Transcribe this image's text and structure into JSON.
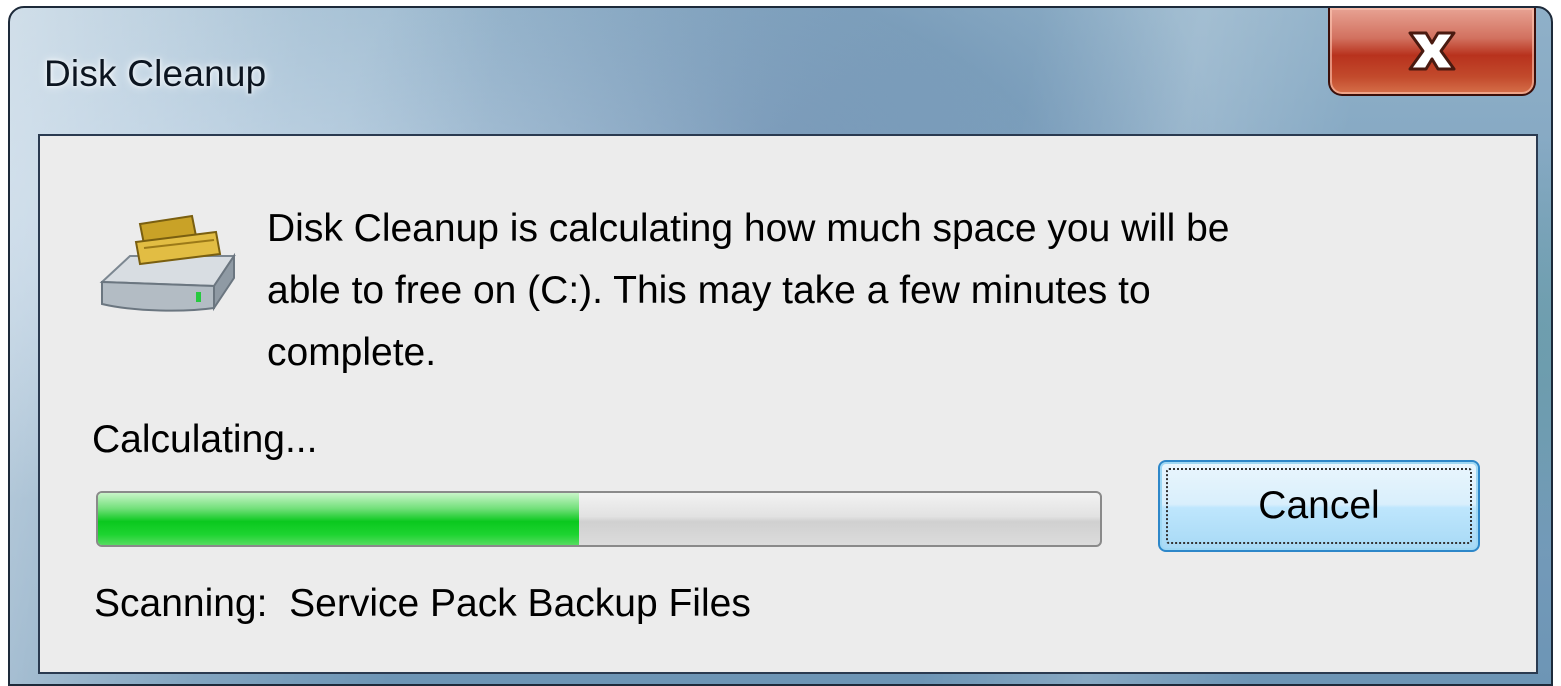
{
  "window": {
    "title": "Disk Cleanup"
  },
  "title_bar": {
    "close_icon": "close-x-icon",
    "close_color": "#c0392b"
  },
  "dialog": {
    "icon": "disk-cleanup-drive-icon",
    "message_lines": [
      "Disk Cleanup is calculating how much space you will be",
      "able to free on  (C:). This may take a few minutes to",
      "complete."
    ],
    "status_label": "Calculating...",
    "progress": {
      "percent": 48,
      "color": "#0ac81e"
    },
    "cancel_label": "Cancel",
    "scan_prefix": "Scanning:",
    "scan_item": "Service Pack Backup Files"
  }
}
